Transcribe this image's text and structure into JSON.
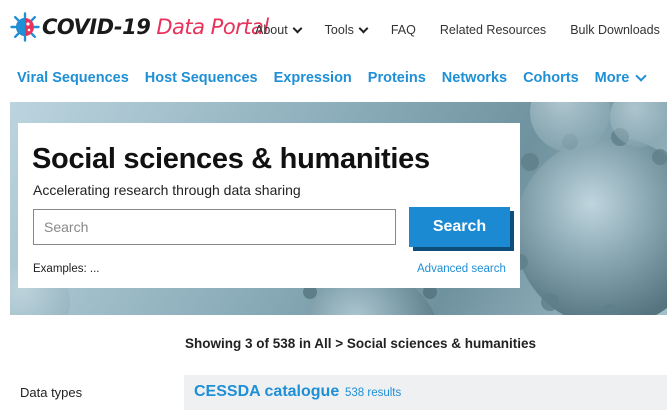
{
  "logo": {
    "main": "COVID-19",
    "accent": "Data Portal"
  },
  "top_nav": [
    {
      "label": "About",
      "dropdown": true
    },
    {
      "label": "Tools",
      "dropdown": true
    },
    {
      "label": "FAQ",
      "dropdown": false
    },
    {
      "label": "Related Resources",
      "dropdown": false
    },
    {
      "label": "Bulk Downloads",
      "dropdown": false
    }
  ],
  "secondary_nav": [
    {
      "label": "Viral Sequences"
    },
    {
      "label": "Host Sequences"
    },
    {
      "label": "Expression"
    },
    {
      "label": "Proteins"
    },
    {
      "label": "Networks"
    },
    {
      "label": "Cohorts"
    },
    {
      "label": "More",
      "dropdown": true
    }
  ],
  "hero": {
    "title": "Social sciences & humanities",
    "subtitle": "Accelerating research through data sharing",
    "search_placeholder": "Search",
    "search_button": "Search",
    "examples": "Examples: ...",
    "advanced_search": "Advanced search"
  },
  "results": {
    "summary": "Showing 3 of 538 in All > Social sciences & humanities",
    "filter_label": "Data types",
    "first_result": {
      "title": "CESSDA catalogue",
      "count": "538 results"
    }
  },
  "colors": {
    "brand_blue": "#1f8fd6",
    "brand_pink": "#e8325a",
    "button_blue": "#1b8ad3",
    "button_shadow": "#0d4e7a"
  },
  "icons": [
    "virus-logo-icon",
    "chevron-down-icon"
  ]
}
